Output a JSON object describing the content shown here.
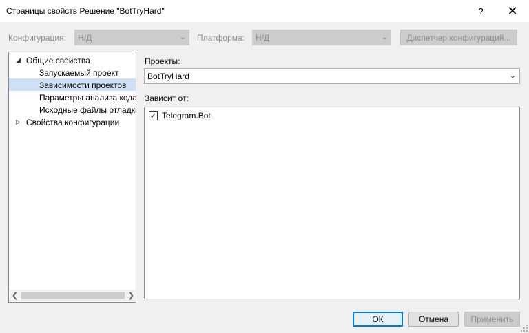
{
  "window": {
    "title": "Страницы свойств Решение \"BotTryHard\"",
    "help_label": "?",
    "close_label": "✕"
  },
  "config_bar": {
    "configuration_label": "Конфигурация:",
    "configuration_value": "Н/Д",
    "platform_label": "Платформа:",
    "platform_value": "Н/Д",
    "manager_label": "Диспетчер конфигураций..."
  },
  "tree": {
    "items": [
      {
        "label": "Общие свойства",
        "expander": "◢"
      },
      {
        "label": "Запускаемый проект"
      },
      {
        "label": "Зависимости проектов",
        "selected": true
      },
      {
        "label": "Параметры анализа кода"
      },
      {
        "label": "Исходные файлы отладки"
      },
      {
        "label": "Свойства конфигурации",
        "expander": "▷"
      }
    ]
  },
  "projects": {
    "label": "Проекты:",
    "selected": "BotTryHard"
  },
  "dependencies": {
    "label": "Зависит от:",
    "items": [
      {
        "label": "Telegram.Bot",
        "checked": true,
        "mark": "✓"
      }
    ]
  },
  "buttons": {
    "ok": "ОК",
    "cancel": "Отмена",
    "apply": "Применить"
  }
}
